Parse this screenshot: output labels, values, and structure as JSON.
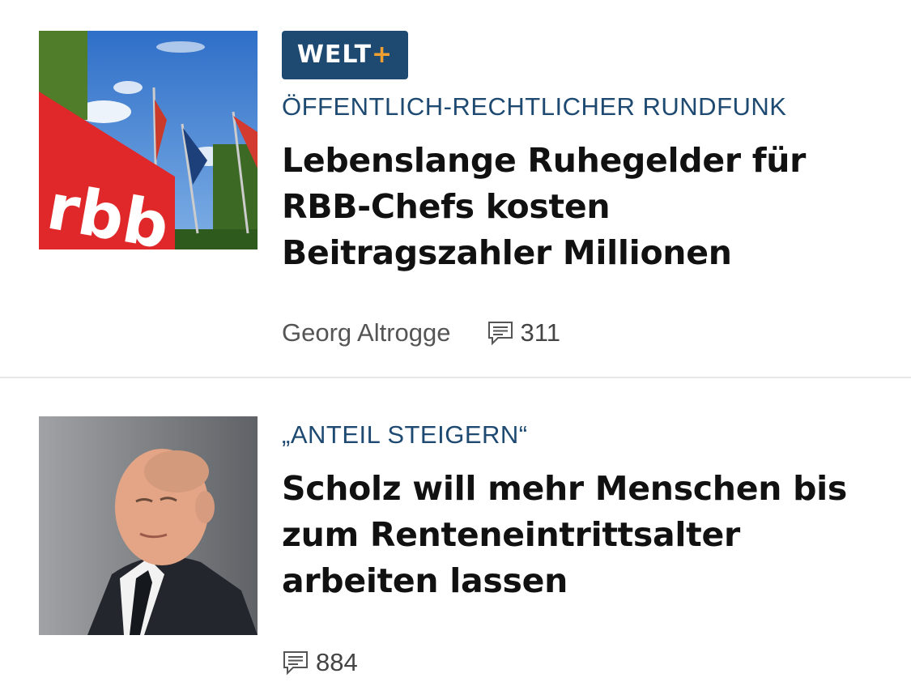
{
  "articles": [
    {
      "badge": {
        "text": "WELT",
        "plus": "+"
      },
      "kicker": "ÖFFENTLICH-RECHTLICHER RUNDFUNK",
      "headline": "Lebenslange Ruhegelder für RBB-Chefs kosten Beitragszahler Millionen",
      "author": "Georg Altrogge",
      "comments": "311",
      "image_text": "rbb"
    },
    {
      "kicker": "„ANTEIL STEIGERN“",
      "headline": "Scholz will mehr Menschen bis zum Renteneintrittsalter arbeiten lassen",
      "comments": "884"
    }
  ],
  "colors": {
    "accent": "#1e4a72",
    "plus": "#f0a030",
    "rbb_red": "#e0282a"
  },
  "icons": {
    "comment": "speech-bubble-icon"
  }
}
